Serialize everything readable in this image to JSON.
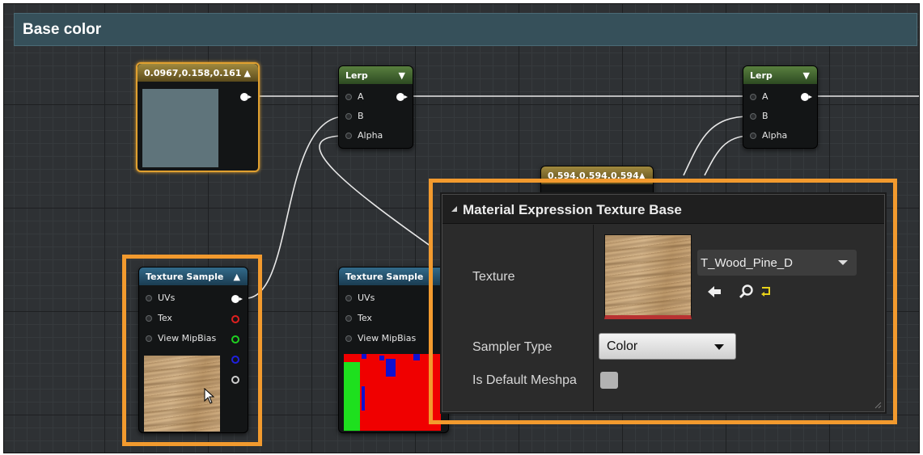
{
  "graph": {
    "title": "Base color"
  },
  "nodes": {
    "const1": {
      "title": "0.0967,0.158,0.161",
      "swatch_color": "#5f747b"
    },
    "const2": {
      "title": "0.594,0.594,0.594"
    },
    "lerp1": {
      "title": "Lerp",
      "pins": [
        "A",
        "B",
        "Alpha"
      ]
    },
    "lerp2": {
      "title": "Lerp",
      "pins": [
        "A",
        "B",
        "Alpha"
      ]
    },
    "tex1": {
      "title": "Texture Sample",
      "pins": [
        "UVs",
        "Tex",
        "View MipBias"
      ]
    },
    "tex2": {
      "title": "Texture Sample",
      "pins": [
        "UVs",
        "Tex",
        "View MipBias"
      ]
    }
  },
  "panel": {
    "title": "Material Expression Texture Base",
    "texture_label": "Texture",
    "texture_value": "T_Wood_Pine_D",
    "sampler_label": "Sampler Type",
    "sampler_value": "Color",
    "default_mesh_label": "Is Default Meshpa"
  },
  "icons": {
    "use_asset": "arrow-left-icon",
    "browse": "search-icon",
    "reset": "reset-arrow-icon"
  },
  "colors": {
    "highlight": "#f29a2e",
    "graph_bg": "#2e3134",
    "title_bar": "#36505a",
    "selected_node_border": "#e0a030"
  }
}
